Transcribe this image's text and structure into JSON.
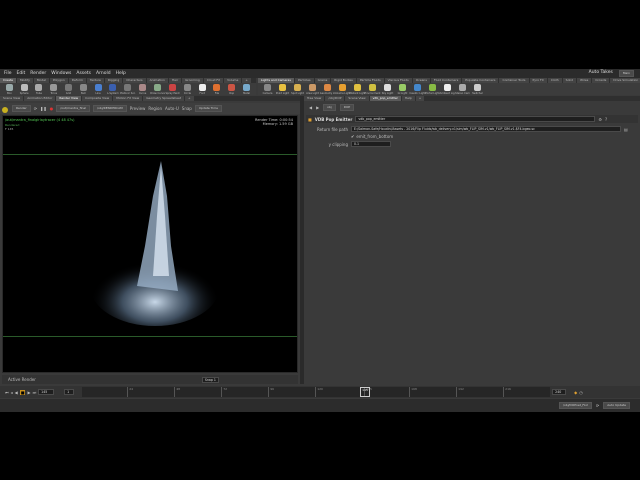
{
  "menu": {
    "items": [
      "File",
      "Edit",
      "Render",
      "Windows",
      "Assets",
      "Arnold",
      "Help"
    ],
    "auto_takes": "Auto Takes",
    "desktop": "Main"
  },
  "shelf_tabs_left": [
    "Create",
    "Modify",
    "Model",
    "Polygon",
    "Deform",
    "Texture",
    "Rigging",
    "Characters",
    "Animation",
    "Hair",
    "Grooming",
    "Cloud FX",
    "Volume",
    "+"
  ],
  "shelf_tabs_right": [
    "Lights and Cameras",
    "Particles",
    "Grains",
    "Rigid Bodies",
    "Particle Fluids",
    "Viscous Fluids",
    "Oceans",
    "Fluid Containers",
    "Populate Containers",
    "Container Tools",
    "Pyro FX",
    "Cloth",
    "Solid",
    "Wires",
    "Crowds",
    "Drive Simulation",
    "+"
  ],
  "tools_left": [
    {
      "label": "Box",
      "color": "#9aa"
    },
    {
      "label": "Sphere",
      "color": "#bbb"
    },
    {
      "label": "Tube",
      "color": "#aaa"
    },
    {
      "label": "Torus",
      "color": "#999"
    },
    {
      "label": "Grid",
      "color": "#777"
    },
    {
      "label": "Null",
      "color": "#888"
    },
    {
      "label": "Line",
      "color": "#4a7fd0"
    },
    {
      "label": "L-System",
      "color": "#3a5fb0"
    },
    {
      "label": "Platonic Sol.",
      "color": "#777"
    },
    {
      "label": "Curve",
      "color": "#a88"
    },
    {
      "label": "Draw Curve",
      "color": "#8a8"
    },
    {
      "label": "Spray Paint",
      "color": "#c44"
    },
    {
      "label": "Circle",
      "color": "#888"
    },
    {
      "label": "Font",
      "color": "#eee"
    },
    {
      "label": "File",
      "color": "#e07030"
    },
    {
      "label": "Rop",
      "color": "#c54"
    },
    {
      "label": "Metal",
      "color": "#7ac"
    }
  ],
  "tools_right": [
    {
      "label": "Camera",
      "color": "#888"
    },
    {
      "label": "Point Light",
      "color": "#e8c040"
    },
    {
      "label": "Spot Light",
      "color": "#d8b050"
    },
    {
      "label": "Area Light",
      "color": "#c96"
    },
    {
      "label": "Geometry L.",
      "color": "#d84"
    },
    {
      "label": "Volume Light",
      "color": "#e8a030"
    },
    {
      "label": "Distant Light",
      "color": "#e0c040"
    },
    {
      "label": "Environment",
      "color": "#d0c040"
    },
    {
      "label": "Sky Light",
      "color": "#ddd"
    },
    {
      "label": "GI Light",
      "color": "#9c6"
    },
    {
      "label": "Caustic Light",
      "color": "#48c"
    },
    {
      "label": "Portal Light",
      "color": "#8b4"
    },
    {
      "label": "Ambient Lig.",
      "color": "#eee"
    },
    {
      "label": "Stereo Cam",
      "color": "#aaa"
    },
    {
      "label": "Switcher",
      "color": "#ccc"
    }
  ],
  "left_panes": [
    "Scene View",
    "Animation Editor",
    "Render View",
    "Composite View",
    "Motion FX View",
    "Geometry Spreadsheet",
    "+"
  ],
  "right_panes": [
    "Tree View",
    "/obj/DOP",
    "Scene View",
    "vdb_pop_emitter",
    "Help",
    "+"
  ],
  "render_toolbar": {
    "render": "Render",
    "renderer": "/out/mantra_final",
    "camera": "/obj/RENDERCAM",
    "preview": "Preview",
    "region": "Region",
    "auto": "Auto-U",
    "snap": "Snap",
    "update_time": "Update Time"
  },
  "viewport": {
    "title": "/out/mantra_finalgirlaytracer (4 48 47s)",
    "line2": "Rendered",
    "line3": "F 145",
    "render_time_label": "Render Time:",
    "render_time": "0:00:54",
    "memory_label": "Memory:",
    "memory": "1.59 GB"
  },
  "view_bottom": {
    "active_render": "Active Render",
    "snap": "Snap 1"
  },
  "path_bar": {
    "network": "obj",
    "node": "DOP"
  },
  "params": {
    "type": "VDB Pop Emitter",
    "name": "vdb_pop_emitter",
    "file_label": "Return file path",
    "file_value": "E:/Salmon-Safe/Houdini/Assets - 2016/Flip Fluids/wb_delivery.v1/sim/wb_FLIP_SIM.v1/wb_FLIP_SIM.v1.$F4.bgeo.sc",
    "checkbox_label": "emit_from_bottom",
    "clip_label": "y clipping",
    "clip_value": "0.1"
  },
  "timeline": {
    "current": "145",
    "step": "1",
    "start": 1,
    "end": 240,
    "end_label": "240",
    "ticks": [
      "24",
      "48",
      "72",
      "96",
      "120",
      "145",
      "168",
      "192",
      "216"
    ]
  },
  "status": {
    "path": "/obj/DOPnet_FLU",
    "auto_update": "Auto Update"
  }
}
